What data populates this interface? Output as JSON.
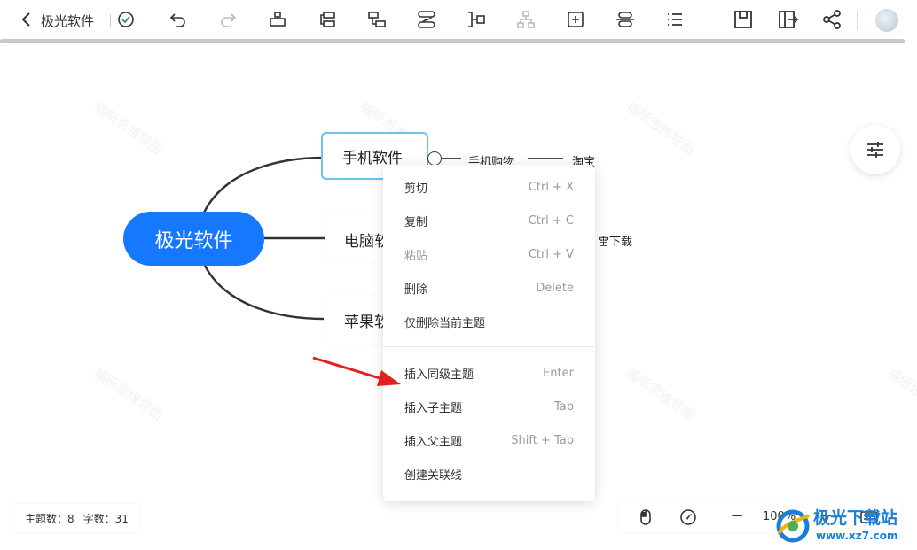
{
  "toolbar": {
    "title": "极光软件",
    "icons": [
      "back-icon",
      "saved-check-icon",
      "undo-icon",
      "redo-icon",
      "insert-parent-icon",
      "insert-sibling-icon",
      "insert-child-icon",
      "relationship-icon",
      "summary-icon",
      "structure-icon",
      "insert-topic-icon",
      "outline-icon",
      "list-icon",
      "save-icon",
      "export-icon",
      "share-icon"
    ]
  },
  "canvas": {
    "watermark": "福昕思维导图",
    "root": "极光软件",
    "children": [
      "手机软件",
      "电脑软件",
      "苹果软件"
    ],
    "children_visible": [
      "手机软件",
      "电脑软",
      "苹果软"
    ],
    "leaves": [
      "手机购物",
      "淘宝",
      "雷下载"
    ]
  },
  "context_menu": {
    "items": [
      {
        "label": "剪切",
        "shortcut": "Ctrl + X"
      },
      {
        "label": "复制",
        "shortcut": "Ctrl + C"
      },
      {
        "label": "粘贴",
        "shortcut": "Ctrl + V"
      },
      {
        "label": "删除",
        "shortcut": "Delete"
      },
      {
        "label": "仅删除当前主题",
        "shortcut": ""
      },
      {
        "label": "插入同级主题",
        "shortcut": "Enter"
      },
      {
        "label": "插入子主题",
        "shortcut": "Tab"
      },
      {
        "label": "插入父主题",
        "shortcut": "Shift + Tab"
      },
      {
        "label": "创建关联线",
        "shortcut": ""
      }
    ]
  },
  "status": {
    "topic_count_label": "主题数：8",
    "word_count_label": "字数：31"
  },
  "zoom": {
    "value": "100%",
    "minus": "−",
    "plus": "+"
  },
  "brand": {
    "name": "极光下载站",
    "url": "www.xz7.com"
  },
  "colors": {
    "root_fill": "#1677ff",
    "selected_border": "#6cc3ee",
    "arrow": "#e02020"
  }
}
